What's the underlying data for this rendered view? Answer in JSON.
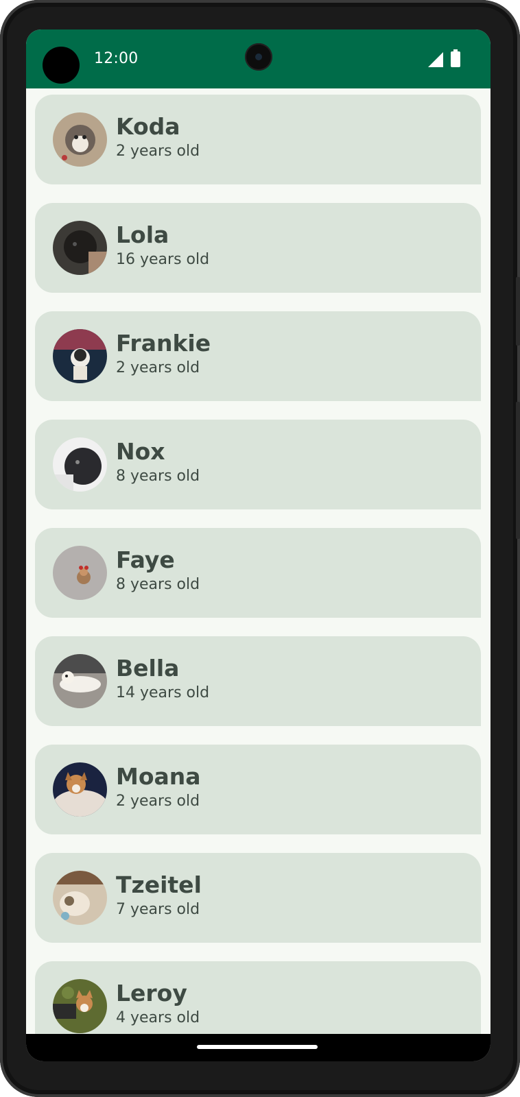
{
  "status_bar": {
    "time": "12:00",
    "background": "#006c49",
    "icons": [
      "signal-icon",
      "battery-icon"
    ]
  },
  "colors": {
    "card": "#dae4da",
    "text": "#3e4a43",
    "screen_bg": "#f6f9f4"
  },
  "dogs": [
    {
      "name": "Koda",
      "age": "2 years old",
      "photo": "husky-photo"
    },
    {
      "name": "Lola",
      "age": "16 years old",
      "photo": "dark-dog-photo"
    },
    {
      "name": "Frankie",
      "age": "2 years old",
      "photo": "small-dog-photo"
    },
    {
      "name": "Nox",
      "age": "8 years old",
      "photo": "black-dog-photo"
    },
    {
      "name": "Faye",
      "age": "8 years old",
      "photo": "small-dog-floor-photo"
    },
    {
      "name": "Bella",
      "age": "14 years old",
      "photo": "white-dog-photo"
    },
    {
      "name": "Moana",
      "age": "2 years old",
      "photo": "corgi-blanket-photo"
    },
    {
      "name": "Tzeitel",
      "age": "7 years old",
      "photo": "sleeping-dog-photo"
    },
    {
      "name": "Leroy",
      "age": "4 years old",
      "photo": "corgi-grass-photo"
    }
  ]
}
